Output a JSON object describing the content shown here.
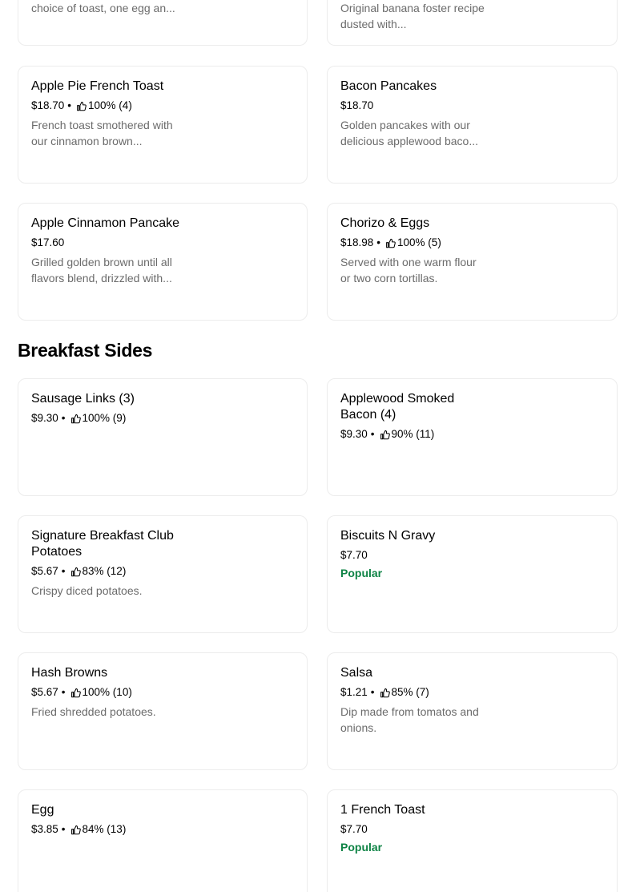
{
  "top_partial": [
    {
      "desc": "choice of toast, one egg an..."
    },
    {
      "desc": "Original banana foster recipe dusted with..."
    }
  ],
  "breakfast_items": [
    {
      "name": "Apple Pie French Toast",
      "price": "$18.70",
      "rating": "100% (4)",
      "desc": "French toast smothered with our cinnamon brown..."
    },
    {
      "name": "Bacon Pancakes",
      "price": "$18.70",
      "rating": "",
      "desc": "Golden pancakes with our delicious applewood baco..."
    },
    {
      "name": "Apple Cinnamon Pancake",
      "price": "$17.60",
      "rating": "",
      "desc": "Grilled golden brown until all flavors blend, drizzled with..."
    },
    {
      "name": "Chorizo & Eggs",
      "price": "$18.98",
      "rating": "100% (5)",
      "desc": "Served with one warm flour or two corn tortillas."
    }
  ],
  "section": {
    "title": "Breakfast Sides"
  },
  "sides_items": [
    {
      "name": "Sausage Links (3)",
      "price": "$9.30",
      "rating": "100% (9)",
      "desc": ""
    },
    {
      "name": "Applewood Smoked Bacon (4)",
      "price": "$9.30",
      "rating": "90% (11)",
      "desc": ""
    },
    {
      "name": "Signature Breakfast Club Potatoes",
      "price": "$5.67",
      "rating": "83% (12)",
      "desc": "Crispy diced potatoes."
    },
    {
      "name": "Biscuits N Gravy",
      "price": "$7.70",
      "rating": "",
      "desc": "",
      "badge": "Popular"
    },
    {
      "name": "Hash Browns",
      "price": "$5.67",
      "rating": "100% (10)",
      "desc": "Fried shredded potatoes."
    },
    {
      "name": "Salsa",
      "price": "$1.21",
      "rating": "85% (7)",
      "desc": "Dip made from tomatos and onions."
    },
    {
      "name": "Egg",
      "price": "$3.85",
      "rating": "84% (13)",
      "desc": ""
    },
    {
      "name": "1 French Toast",
      "price": "$7.70",
      "rating": "",
      "desc": "",
      "badge": "Popular"
    }
  ],
  "separator": "•",
  "icons": {
    "rating": "thumbs-up-icon"
  },
  "colors": {
    "popular": "#0e8345",
    "desc": "#6b6b6b",
    "border": "#ececec"
  }
}
